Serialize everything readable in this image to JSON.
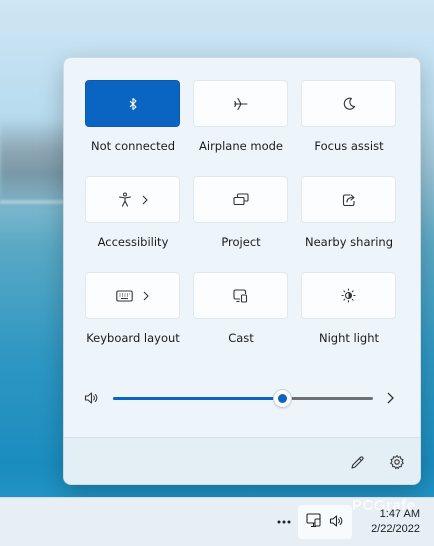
{
  "quick_settings": {
    "tiles": [
      {
        "label": "Not connected",
        "icon": "bluetooth-icon",
        "active": true
      },
      {
        "label": "Airplane mode",
        "icon": "airplane-icon",
        "active": false
      },
      {
        "label": "Focus assist",
        "icon": "moon-icon",
        "active": false
      },
      {
        "label": "Accessibility",
        "icon": "accessibility-icon",
        "active": false,
        "has_chevron": true
      },
      {
        "label": "Project",
        "icon": "project-icon",
        "active": false
      },
      {
        "label": "Nearby sharing",
        "icon": "share-icon",
        "active": false
      },
      {
        "label": "Keyboard layout",
        "icon": "keyboard-icon",
        "active": false,
        "has_chevron": true
      },
      {
        "label": "Cast",
        "icon": "cast-icon",
        "active": false
      },
      {
        "label": "Night light",
        "icon": "night-light-icon",
        "active": false
      }
    ],
    "volume": {
      "level_percent": 65,
      "icon": "speaker-icon"
    }
  },
  "footer": {
    "edit_icon": "pencil-icon",
    "settings_icon": "gear-icon"
  },
  "taskbar": {
    "time": "1:47 AM",
    "date": "2/22/2022"
  },
  "watermark": "PCGrafe",
  "colors": {
    "accent": "#0a64c2",
    "panel": "#eef5fa",
    "tile": "#fbfdfe"
  }
}
